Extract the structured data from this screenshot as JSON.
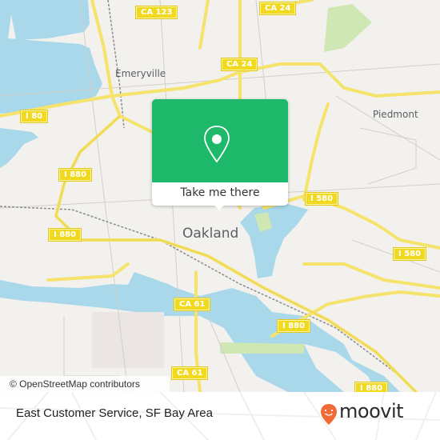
{
  "map": {
    "places": [
      {
        "name": "Emeryville",
        "size": "small"
      },
      {
        "name": "Piedmont",
        "size": "small"
      },
      {
        "name": "Oakland",
        "size": "big"
      }
    ],
    "shields": [
      "CA 123",
      "CA 24",
      "CA 24",
      "I 80",
      "I 880",
      "I 880",
      "I 580",
      "I 580",
      "CA 61",
      "I 880",
      "CA 61",
      "I 880"
    ],
    "attribution": "© OpenStreetMap contributors",
    "colors": {
      "land": "#f2f1ee",
      "water": "#a8d8ea",
      "highway": "#f5e36b",
      "park": "#cfe8b3",
      "accent": "#1db86a"
    }
  },
  "popup": {
    "icon": "map-pin-icon",
    "button_label": "Take me there"
  },
  "footer": {
    "title": "East Customer Service, SF Bay Area",
    "brand": "moovit",
    "brand_color": "#f26a36"
  }
}
